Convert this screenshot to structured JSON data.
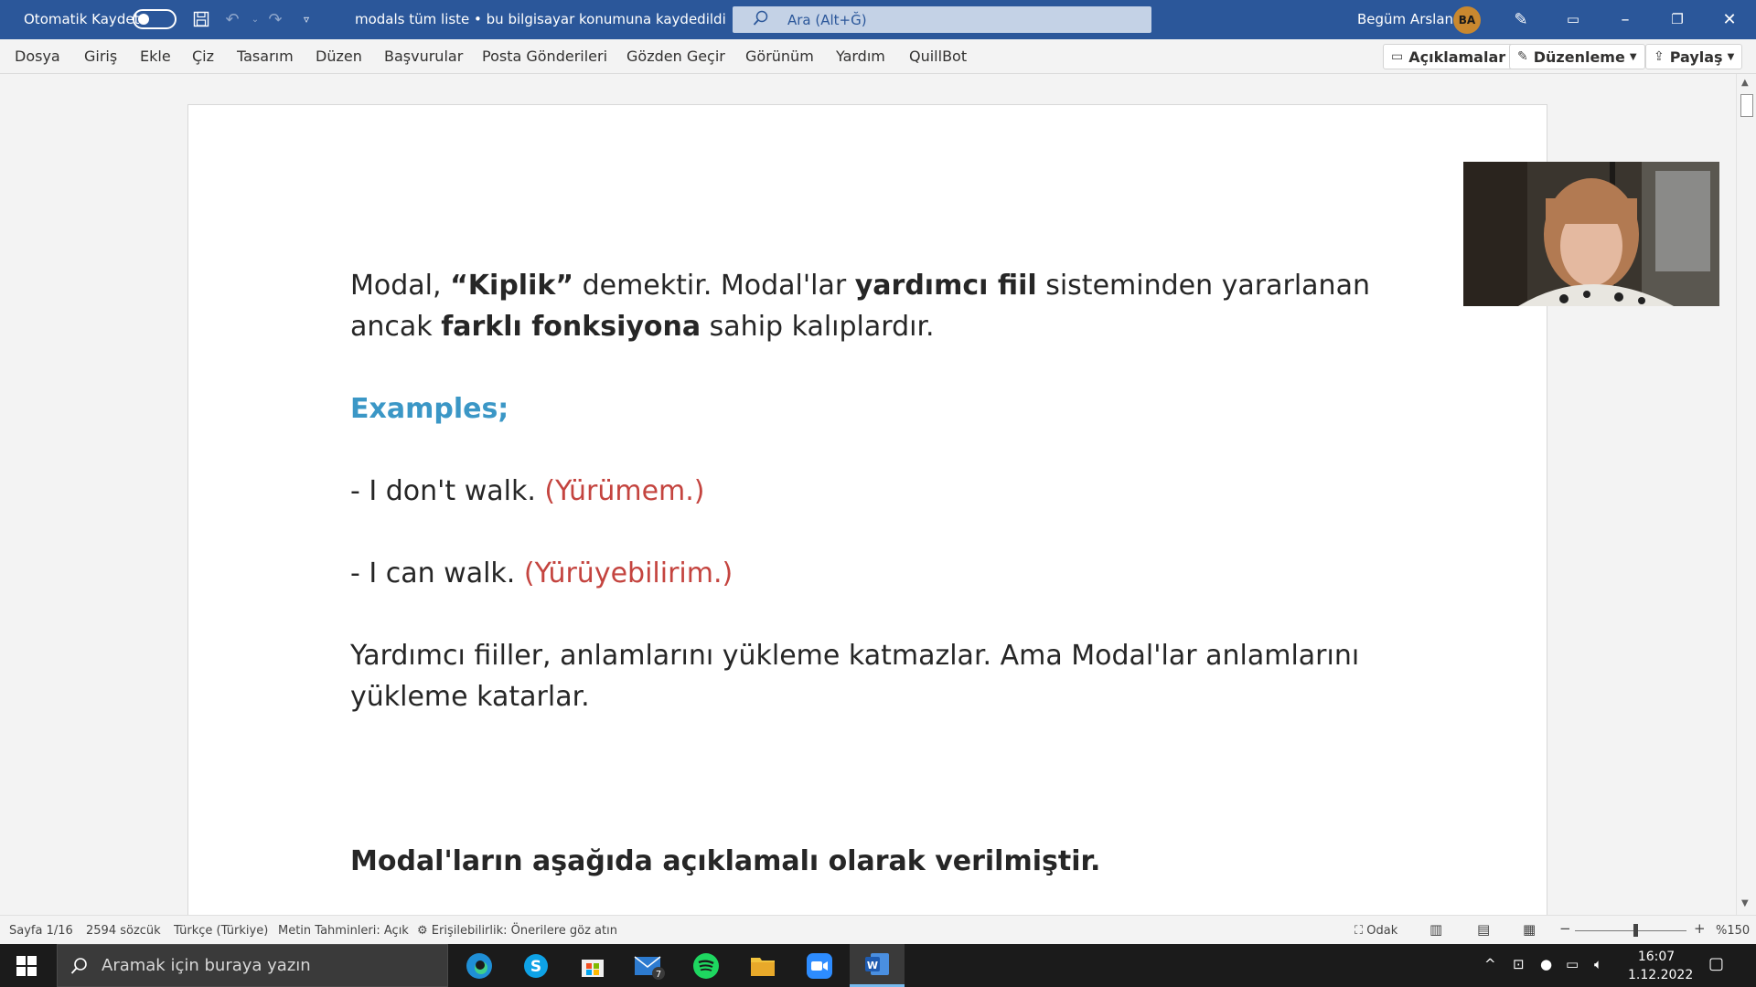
{
  "titlebar": {
    "autosave_label": "Otomatik Kaydet",
    "document_title": "modals tüm liste • bu bilgisayar konumuna kaydedildi",
    "search_placeholder": "Ara (Alt+Ğ)",
    "user_name": "Begüm Arslan",
    "user_initials": "BA"
  },
  "ribbon": {
    "tabs": [
      "Dosya",
      "Giriş",
      "Ekle",
      "Çiz",
      "Tasarım",
      "Düzen",
      "Başvurular",
      "Posta Gönderileri",
      "Gözden Geçir",
      "Görünüm",
      "Yardım",
      "QuillBot"
    ],
    "comments_label": "Açıklamalar",
    "editing_label": "Düzenleme",
    "share_label": "Paylaş"
  },
  "document": {
    "p1_a": "Modal, ",
    "p1_b": "“Kiplik”",
    "p1_c": " demektir. Modal'lar ",
    "p1_d": "yardımcı fiil",
    "p1_e": " sisteminden yararlanan ancak ",
    "p1_f": "farklı fonksiyona",
    "p1_g": " sahip kalıplardır.",
    "examples_heading": "Examples;",
    "ex1_en": "- I don't walk. ",
    "ex1_tr": "(Yürümem.)",
    "ex2_en": "- I can walk. ",
    "ex2_tr": "(Yürüyebilirim.)",
    "p2": " Yardımcı fiiller, anlamlarını yükleme katmazlar. Ama Modal'lar anlamlarını yükleme katarlar.",
    "heading2": "Modal'ların aşağıda açıklamalı olarak verilmiştir."
  },
  "statusbar": {
    "page": "Sayfa 1/16",
    "words": "2594 sözcük",
    "language": "Türkçe (Türkiye)",
    "predictions": "Metin Tahminleri: Açık",
    "accessibility": "Erişilebilirlik: Önerilere göz atın",
    "focus": "Odak",
    "zoom": "%150"
  },
  "taskbar": {
    "search_placeholder": "Aramak için buraya yazın",
    "mail_badge": "7",
    "time": "16:07",
    "date": "1.12.2022"
  },
  "colors": {
    "word_blue": "#2b579a",
    "heading_blue": "#3b97c6",
    "translation_red": "#c4443f"
  }
}
